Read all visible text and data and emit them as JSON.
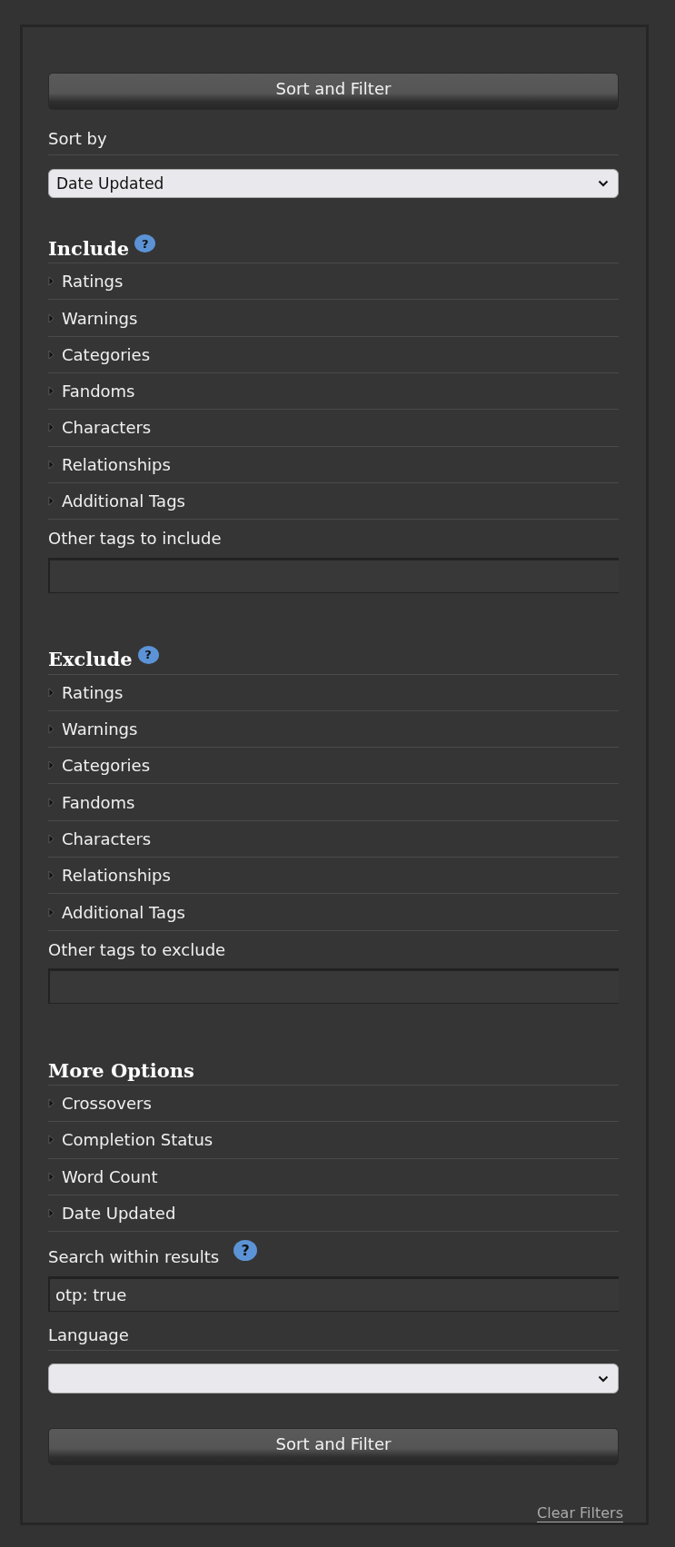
{
  "top_button": "Sort and Filter",
  "sort_by": {
    "label": "Sort by",
    "value": "Date Updated"
  },
  "groups": [
    {
      "heading": "Include",
      "help": "?",
      "filters": [
        {
          "label": "Ratings",
          "expanded": false
        },
        {
          "label": "Warnings",
          "expanded": false
        },
        {
          "label": "Categories",
          "expanded": false
        },
        {
          "label": "Fandoms",
          "expanded": false
        },
        {
          "label": "Characters",
          "expanded": false
        },
        {
          "label": "Relationships",
          "expanded": false
        },
        {
          "label": "Additional Tags",
          "expanded": false
        }
      ],
      "other_label": "Other tags to include"
    },
    {
      "heading": "Exclude",
      "help": "?",
      "filters": [
        {
          "label": "Ratings",
          "expanded": false
        },
        {
          "label": "Warnings",
          "expanded": false
        },
        {
          "label": "Categories",
          "expanded": false
        },
        {
          "label": "Fandoms",
          "expanded": false
        },
        {
          "label": "Characters",
          "expanded": false
        },
        {
          "label": "Relationships",
          "expanded": false
        },
        {
          "label": "Additional Tags",
          "expanded": false
        }
      ],
      "other_label": "Other tags to exclude"
    }
  ],
  "more_options": {
    "heading": "More Options",
    "filters": [
      {
        "label": "Crossovers",
        "expanded": false
      },
      {
        "label": "Completion Status",
        "expanded": false
      },
      {
        "label": "Word Count",
        "expanded": false
      },
      {
        "label": "Date Updated",
        "expanded": false
      }
    ]
  },
  "search_within": {
    "label": "Search within results",
    "help": "?",
    "value": "otp: true"
  },
  "language": {
    "label": "Language"
  },
  "bottom_button": "Sort and Filter",
  "clear_filters": "Clear Filters"
}
